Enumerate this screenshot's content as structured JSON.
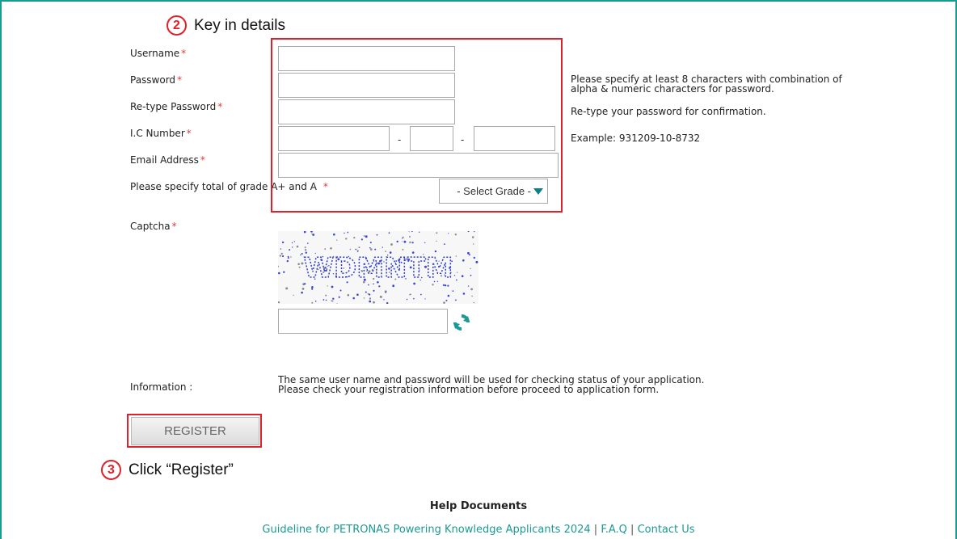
{
  "callouts": {
    "step2": {
      "number": "2",
      "text": "Key in details"
    },
    "step3": {
      "number": "3",
      "text": "Click “Register”"
    }
  },
  "form": {
    "required_mark": "*",
    "username_label": "Username",
    "password_label": "Password",
    "retype_label": "Re-type Password",
    "ic_label": "I.C Number",
    "email_label": "Email Address",
    "grade_label": "Please specify total of grade A+ and A",
    "grade_select_value": "- Select Grade -",
    "captcha_label": "Captcha",
    "captcha_text": "WDMNTM",
    "ic_separator": "-",
    "information_label": "Information :"
  },
  "hints": {
    "password_line1": "Please specify at least 8 characters with combination of",
    "password_line2": "alpha & numeric characters for password.",
    "retype": "Re-type your password for confirmation.",
    "ic_example": "Example: 931209-10-8732"
  },
  "information": {
    "line1": "The same user name and password will be used for checking status of your application.",
    "line2": "Please check your registration information before proceed to application form."
  },
  "register_button": "REGISTER",
  "help": {
    "title": "Help Documents",
    "links": [
      "Guideline for PETRONAS Powering Knowledge Applicants 2024",
      "F.A.Q",
      "Contact Us"
    ],
    "separator": "|"
  },
  "colors": {
    "frame": "#179c93",
    "highlight": "#e0202a",
    "link": "#1a9a92",
    "required": "#e23a3a",
    "captcha_text": "#2b3bd6"
  },
  "icons": {
    "refresh": "refresh-icon",
    "dropdown": "caret-down-icon"
  }
}
